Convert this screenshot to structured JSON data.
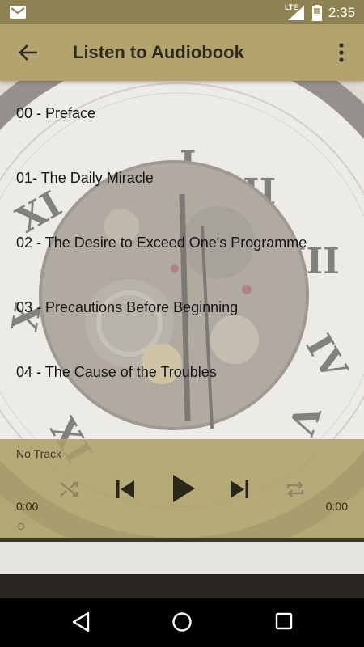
{
  "status_bar": {
    "network": "LTE",
    "time": "2:35",
    "icons": [
      "gmail-icon",
      "signal-icon",
      "battery-icon"
    ]
  },
  "app_bar": {
    "title": "Listen to Audiobook",
    "icons": [
      "back-arrow-icon",
      "overflow-menu-icon"
    ]
  },
  "tracks": [
    {
      "label": "00 - Preface"
    },
    {
      "label": "01- The Daily Miracle"
    },
    {
      "label": "02 - The Desire to Exceed One's Programme"
    },
    {
      "label": "03 - Precautions Before Beginning"
    },
    {
      "label": "04 - The Cause of the Troubles"
    }
  ],
  "player": {
    "track_name": "No Track",
    "elapsed": "0:00",
    "duration": "0:00",
    "progress": 0,
    "icons": [
      "shuffle-icon",
      "skip-previous-icon",
      "play-icon",
      "skip-next-icon",
      "repeat-icon"
    ]
  },
  "nav_bar": {
    "icons": [
      "back-triangle-icon",
      "home-circle-icon",
      "recents-square-icon"
    ]
  },
  "colors": {
    "accent": "#b3a36e",
    "status_bar": "#8e8152",
    "title_text": "#2e2a1c"
  }
}
